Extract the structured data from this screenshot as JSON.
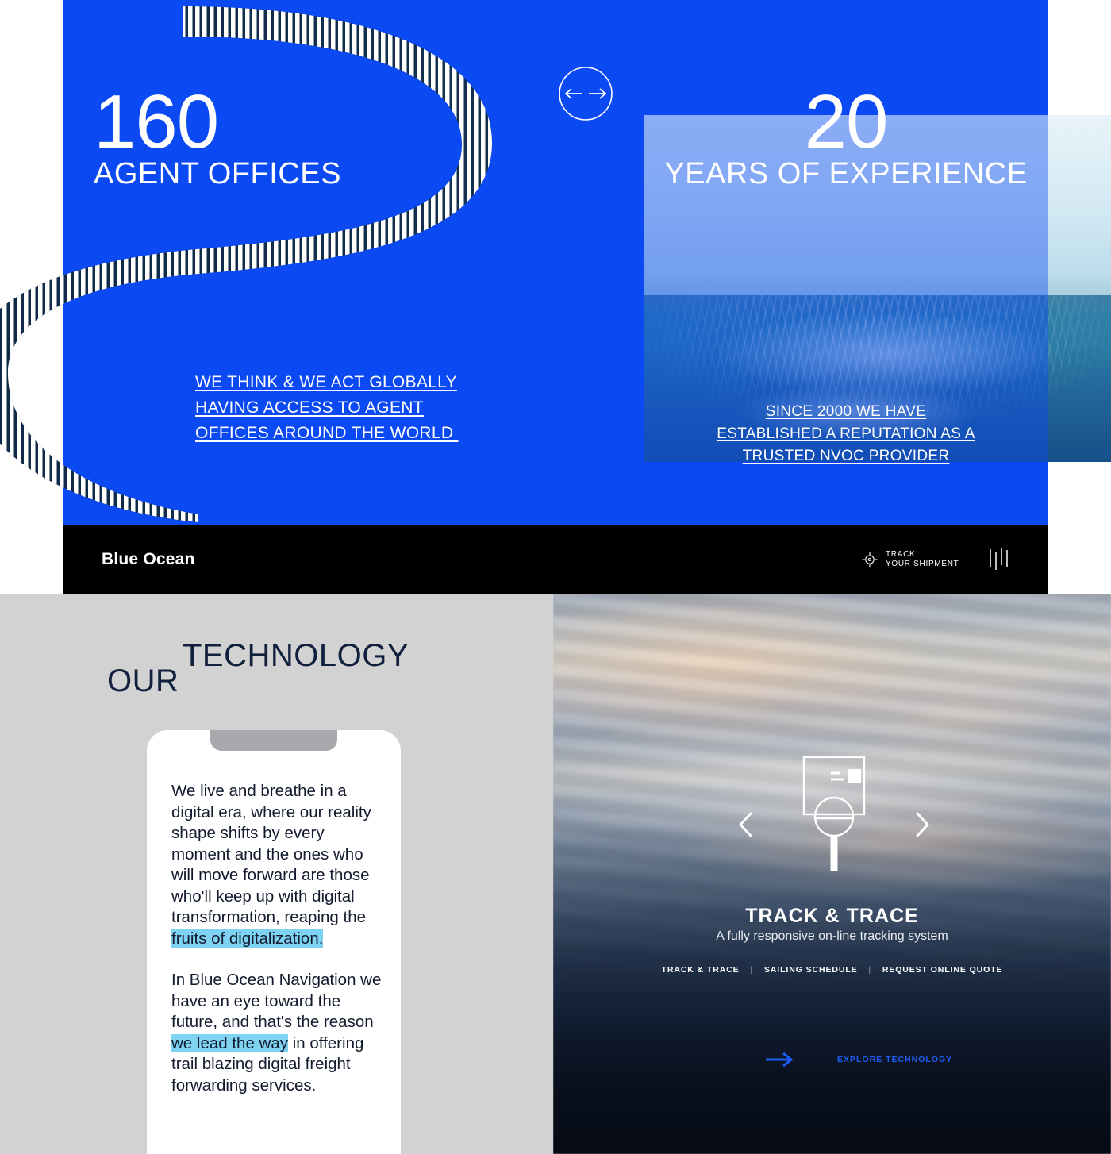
{
  "hero": {
    "left_stat": {
      "number": "160",
      "label": "AGENT OFFICES"
    },
    "left_links": [
      "WE THINK & WE ACT GLOBALLY",
      "HAVING ACCESS TO AGENT",
      "OFFICES AROUND THE WORLD "
    ],
    "right_stat": {
      "number": "20",
      "label": "YEARS OF EXPERIENCE"
    },
    "right_links": [
      "SINCE 2000 WE HAVE",
      "ESTABLISHED A REPUTATION AS A",
      "TRUSTED NVOC PROVIDER"
    ],
    "arrows_icon": "left-right-arrows-icon",
    "blue": "#0B49F2"
  },
  "navbar": {
    "brand": "Blue Ocean",
    "track": {
      "line1": "TRACK",
      "line2": "YOUR SHIPMENT",
      "icon": "target-crosshair-icon"
    },
    "menu_icon": "menu-bars-icon",
    "background": "#000000"
  },
  "technology": {
    "heading_secondary": "OUR",
    "heading_primary": "TECHNOLOGY",
    "heading_color": "#11203C",
    "phone": {
      "paragraph1_a": "We live and breathe in a digital era, where our reality shape shifts by every moment and the ones who will move forward are those who'll keep up with digital transformation, reaping the ",
      "paragraph1_hl": "fruits of digitalization.",
      "paragraph2_a": "In Blue Ocean Navigation we have an eye toward the future, and that's the reason ",
      "paragraph2_hl": "we lead the way",
      "paragraph2_b": " in offering trail blazing digital freight forwarding services.",
      "highlight_color": "#7ED3F2"
    }
  },
  "panel": {
    "title": "TRACK & TRACE",
    "subtitle": "A fully responsive on-line tracking system",
    "links": [
      "TRACK & TRACE",
      "SAILING SCHEDULE",
      "REQUEST ONLINE QUOTE"
    ],
    "separator": "|",
    "explore_label": "EXPLORE TECHNOLOGY",
    "explore_color": "#1F5CF5",
    "prev_icon": "chevron-left-icon",
    "next_icon": "chevron-right-icon",
    "feature_icon": "magnifier-over-document-icon"
  }
}
